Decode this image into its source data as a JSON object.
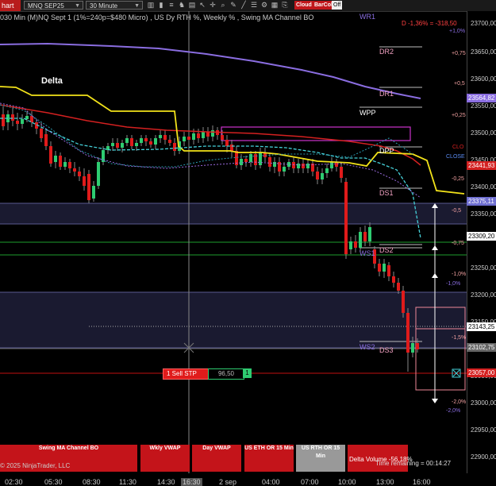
{
  "toolbar": {
    "chart_tab": "hart",
    "instrument": "MNQ SEP25",
    "timeframe": "30 Minute",
    "cloud_label": "Cloud",
    "barcol_label": "BarCol",
    "off_label": "Off"
  },
  "chart_title": "030 Min (M)NQ Sept 1  (1%=240p=$480 Micro) , US Dy RTH %, Weekly % , Swing MA Channel BO",
  "delta_label": "Delta",
  "daily_change": "D -1,36% = -318,50",
  "levels": {
    "wr1": "WR1",
    "dr2": "DR2",
    "dr1": "DR1",
    "wpp": "WPP",
    "dpp": "DPP",
    "ds1": "DS1",
    "ds2": "DS2",
    "ws1": "WS1",
    "ws2": "WS2",
    "ds3": "DS3",
    "close": "CLOSE",
    "clo": "CLO"
  },
  "pct_right": [
    "+1,0%",
    "+0,75",
    "+0,5",
    "+0,25",
    "-0,25",
    "-0,5",
    "-0,75",
    "-1,0%",
    "-1,5%",
    "-2,0%"
  ],
  "pct_left": [
    "+1,0%",
    "-1,0%",
    "-2,0%"
  ],
  "price_axis": [
    "23700,00",
    "23650,00",
    "23600,00",
    "23550,00",
    "23500,00",
    "23450,00",
    "23400,00",
    "23350,00",
    "23250,00",
    "23200,00",
    "23150,00",
    "23050,00",
    "23000,00",
    "22950,00",
    "22900,00"
  ],
  "price_labels": {
    "p1": "23564,82",
    "p2": "23441,93",
    "p3": "23375,11",
    "p4": "23309,20",
    "p5": "23143,25",
    "p6": "23102,75",
    "p7": "23057,00"
  },
  "order": {
    "label": "1  Sell STP",
    "price": "96,50",
    "qty": "1"
  },
  "bottom_buttons": [
    "Swing MA Channel BO",
    "Wkly VWAP",
    "Day VWAP",
    "US ETH OR 15 Min",
    "US RTH OR 15 Min"
  ],
  "copyright": "© 2025 NinjaTrader, LLC",
  "delta_volume": "Delta Volume -56,18%",
  "time_remaining": "Time remaining = 00:14:27",
  "x_axis": [
    "02:30",
    "05:30",
    "08:30",
    "11:30",
    "14:30",
    "16:30",
    "2 sep",
    "04:00",
    "07:00",
    "10:00",
    "13:00",
    "16:00"
  ],
  "colors": {
    "up": "#2ecc71",
    "down": "#e01b1b",
    "yellow": "#f2e21a",
    "purple": "#8a6de0",
    "cyan": "#45d0d8",
    "red_ma": "#d42020",
    "magenta": "#cc33cc"
  }
}
